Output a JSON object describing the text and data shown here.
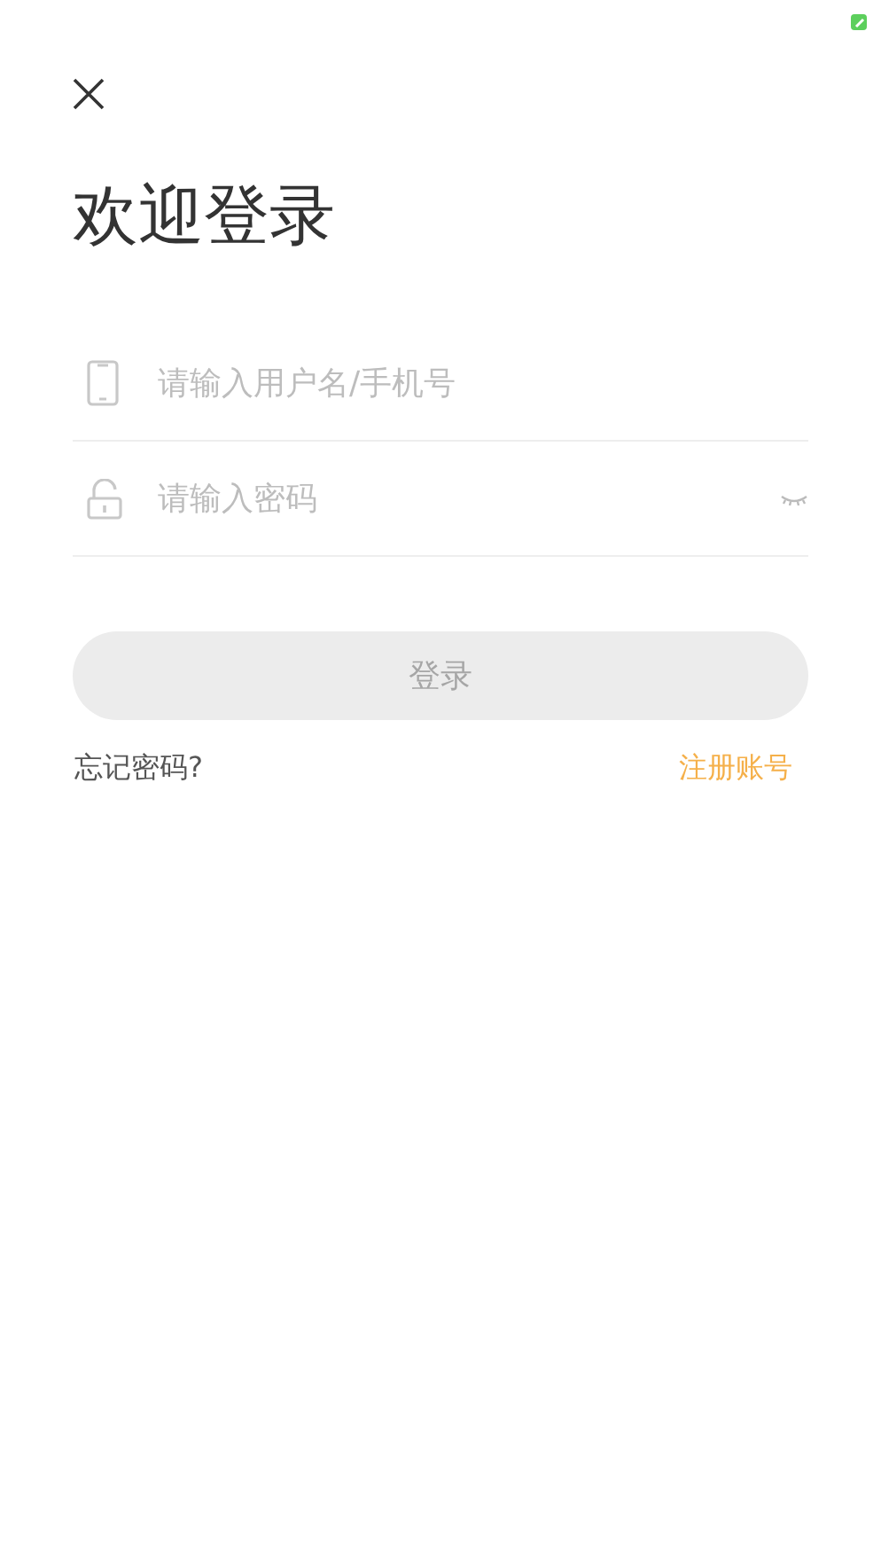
{
  "title": "欢迎登录",
  "fields": [
    {
      "kind": "phone",
      "placeholder": "请输入用户名/手机号"
    },
    {
      "kind": "password",
      "placeholder": "请输入密码",
      "password_visible": false
    }
  ],
  "login_button": {
    "label": "登录",
    "disabled": true
  },
  "forgot_link": "忘记密码?",
  "register_link": "注册账号"
}
